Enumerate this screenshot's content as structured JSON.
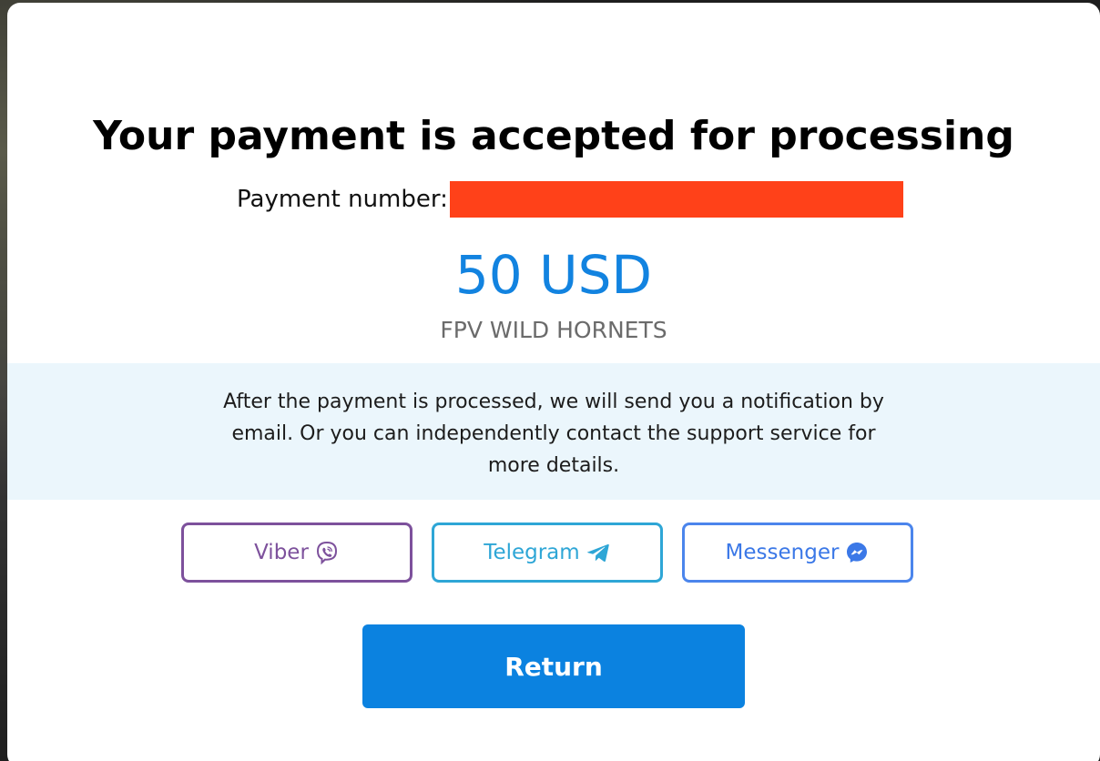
{
  "modal": {
    "title": "Your payment is accepted for processing",
    "payment_number_label": "Payment number:",
    "amount": "50 USD",
    "merchant": "FPV WILD HORNETS",
    "info_text": "After the payment is processed, we will send you a notification by email. Or you can independently contact the support service for more details."
  },
  "contacts": {
    "viber": {
      "label": "Viber",
      "icon": "viber-icon",
      "color": "#7d519c"
    },
    "telegram": {
      "label": "Telegram",
      "icon": "telegram-icon",
      "color": "#2ea6d6"
    },
    "messenger": {
      "label": "Messenger",
      "icon": "messenger-icon",
      "color": "#3b78e7"
    }
  },
  "actions": {
    "return_label": "Return"
  },
  "colors": {
    "amount": "#1283e0",
    "primary_button": "#0b82e0",
    "info_background": "#ebf6fc",
    "redaction": "#ff4119"
  }
}
